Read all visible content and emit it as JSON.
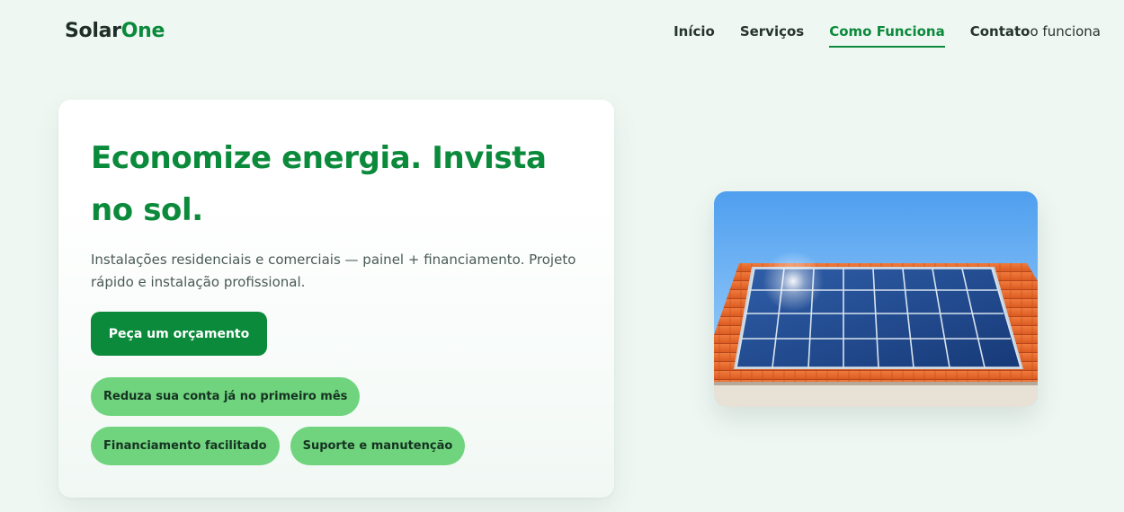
{
  "brand": {
    "name_part1": "Solar",
    "name_part2": "One",
    "accent_color": "#0b8a3b",
    "chip_color": "#6fd47d"
  },
  "nav": {
    "items": [
      {
        "label": "Início"
      },
      {
        "label": "Serviços"
      },
      {
        "label": "Como Funciona",
        "active": true
      },
      {
        "label": "Contato",
        "suffix": "o funciona"
      }
    ]
  },
  "hero": {
    "title": "Economize energia. Invista no sol.",
    "description": "Instalações residenciais e comerciais — painel + financiamento. Projeto rápido e instalação profissional.",
    "cta_label": "Peça um orçamento",
    "features": [
      "Reduza sua conta já no primeiro mês",
      "Financiamento facilitado",
      "Suporte e manutenção"
    ],
    "image_icon": "solar-panel-roof-illustration"
  }
}
